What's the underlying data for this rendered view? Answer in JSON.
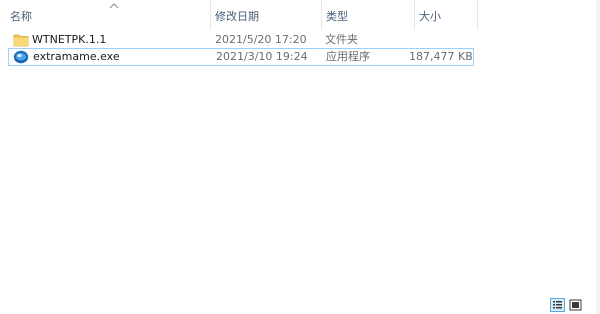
{
  "columns": {
    "name": "名称",
    "date": "修改日期",
    "type": "类型",
    "size": "大小"
  },
  "files": [
    {
      "name": "WTNETPK.1.1",
      "date": "2021/5/20 17:20",
      "type": "文件夹",
      "size": "",
      "icon": "folder-icon"
    },
    {
      "name": "extramame.exe",
      "date": "2021/3/10 19:24",
      "type": "应用程序",
      "size": "187,477 KB",
      "icon": "application-icon"
    }
  ],
  "colors": {
    "header_text": "#4c607a",
    "selection_border": "#99d1ff",
    "folder": "#f2c95a",
    "meta_text": "#6d6d6d"
  }
}
